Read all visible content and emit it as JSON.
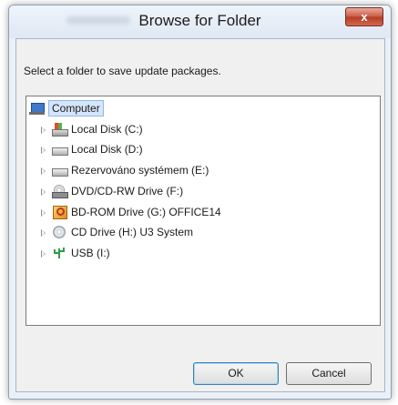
{
  "dialog": {
    "title": "Browse for Folder",
    "close_label": "x",
    "prompt": "Select a folder to save update packages."
  },
  "tree": {
    "root_label": "Computer",
    "items": [
      {
        "label": "Local Disk (C:)",
        "icon": "windows-drive-icon"
      },
      {
        "label": "Local Disk (D:)",
        "icon": "hard-disk-icon"
      },
      {
        "label": "Rezervováno systémem (E:)",
        "icon": "hard-disk-icon"
      },
      {
        "label": "DVD/CD-RW Drive (F:)",
        "icon": "dvd-drive-icon"
      },
      {
        "label": "BD-ROM Drive (G:) OFFICE14",
        "icon": "bd-rom-icon"
      },
      {
        "label": "CD Drive (H:) U3 System",
        "icon": "cd-drive-icon"
      },
      {
        "label": "USB (I:)",
        "icon": "usb-icon"
      }
    ]
  },
  "buttons": {
    "ok": "OK",
    "cancel": "Cancel"
  }
}
